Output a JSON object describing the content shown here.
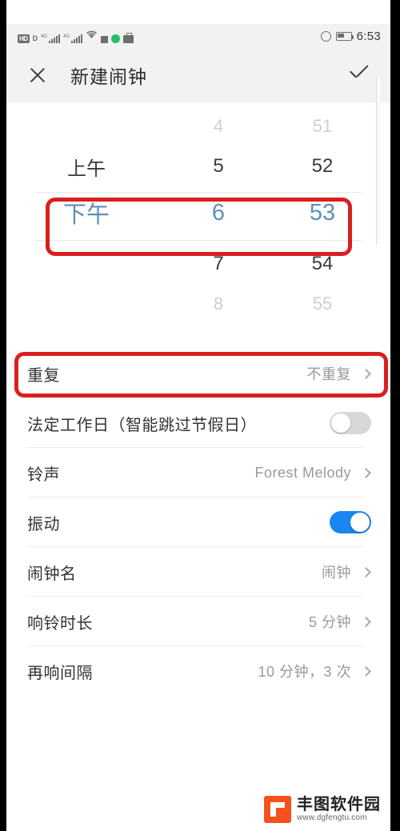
{
  "status_bar": {
    "icons": [
      "hd-icon",
      "d-icon",
      "4g-signal-icon-1",
      "4g-signal-icon-2",
      "wifi-icon",
      "square-icon",
      "green-dot-icon",
      "briefcase-icon"
    ],
    "hd_label": "HD",
    "d_label": "D",
    "network_label": "4G",
    "alarm_icon": "alarm-icon",
    "battery_icon": "battery-icon",
    "time": "6:53"
  },
  "title_bar": {
    "close_icon": "close-icon",
    "title": "新建闹钟",
    "confirm_icon": "check-icon"
  },
  "time_picker": {
    "columns": [
      "ampm",
      "hour",
      "minute"
    ],
    "rows": [
      {
        "ampm": "",
        "hour": "4",
        "minute": "51"
      },
      {
        "ampm": "上午",
        "hour": "5",
        "minute": "52"
      },
      {
        "ampm": "下午",
        "hour": "6",
        "minute": "53"
      },
      {
        "ampm": "",
        "hour": "7",
        "minute": "54"
      },
      {
        "ampm": "",
        "hour": "8",
        "minute": "55"
      }
    ],
    "selected": {
      "ampm": "下午",
      "hour": "6",
      "minute": "53"
    },
    "selected_color": "#5d90b8"
  },
  "settings": {
    "rows": [
      {
        "label": "重复",
        "value": "不重复",
        "control": "chevron"
      },
      {
        "label": "法定工作日（智能跳过节假日）",
        "value": "",
        "control": "toggle-off"
      },
      {
        "label": "铃声",
        "value": "Forest Melody",
        "control": "chevron"
      },
      {
        "label": "振动",
        "value": "",
        "control": "toggle-on"
      },
      {
        "label": "闹钟名",
        "value": "闹钟",
        "control": "chevron"
      },
      {
        "label": "响铃时长",
        "value": "5 分钟",
        "control": "chevron"
      },
      {
        "label": "再响间隔",
        "value": "10 分钟，3 次",
        "control": "chevron"
      }
    ],
    "toggle_on_color": "#1a86f0",
    "toggle_off_color": "#d8d8d8"
  },
  "annotations": {
    "color": "#d81f1f",
    "boxes": [
      "selected-time-row",
      "repeat-row"
    ]
  },
  "watermark": {
    "name": "丰图软件园",
    "url": "www.dgfengtu.com",
    "color": "#f4511e"
  }
}
